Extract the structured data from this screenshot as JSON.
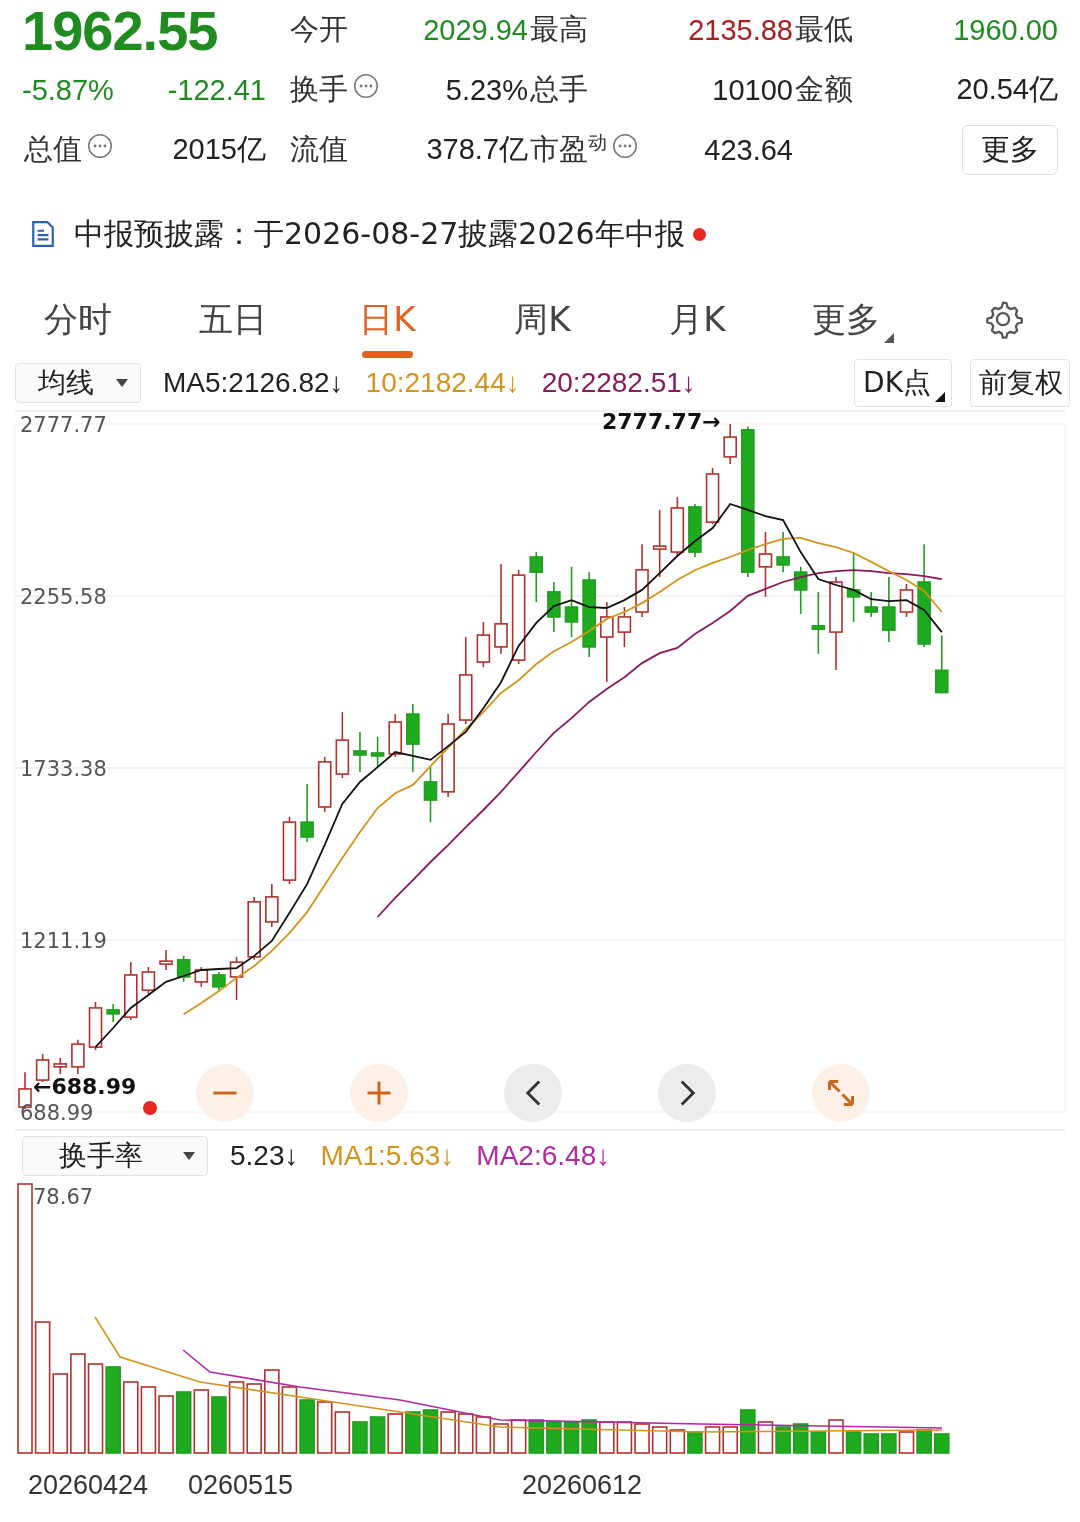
{
  "quote": {
    "price": "1962.55",
    "change_pct": "-5.87%",
    "change": "-122.41",
    "color": "#1f8c1f"
  },
  "stats": [
    {
      "label": "今开",
      "value": "2029.94",
      "color": "#1f8c1f",
      "info": false
    },
    {
      "label": "最高",
      "value": "2135.88",
      "color": "#a8211f",
      "info": false
    },
    {
      "label": "最低",
      "value": "1960.00",
      "color": "#1f8c1f",
      "info": false
    },
    {
      "label": "换手",
      "value": "5.23%",
      "color": "#222222",
      "info": true
    },
    {
      "label": "总手",
      "value": "10100",
      "color": "#222222",
      "info": false
    },
    {
      "label": "金额",
      "value": "20.54亿",
      "color": "#222222",
      "info": false
    },
    {
      "label": "总值",
      "value": "2015亿",
      "color": "#222222",
      "info": true
    },
    {
      "label": "流值",
      "value": "378.7亿",
      "color": "#222222",
      "info": false
    },
    {
      "label": "市盈",
      "sup": "动",
      "value": "423.64",
      "color": "#222222",
      "info": true
    }
  ],
  "more_button": "更多",
  "notice": {
    "text": "中报预披露：于2026-08-27披露2026年中报",
    "unread": true
  },
  "tabs": [
    {
      "label": "分时",
      "selected": false,
      "dropdown": false
    },
    {
      "label": "五日",
      "selected": false,
      "dropdown": false
    },
    {
      "label": "日K",
      "selected": true,
      "dropdown": false
    },
    {
      "label": "周K",
      "selected": false,
      "dropdown": false
    },
    {
      "label": "月K",
      "selected": false,
      "dropdown": false
    },
    {
      "label": "更多",
      "selected": false,
      "dropdown": true
    }
  ],
  "ma_bar": {
    "selector": "均线",
    "legend": [
      {
        "text": "MA5:2126.82↓",
        "color": "#222222"
      },
      {
        "text": "10:2182.44↓",
        "color": "#d4941c"
      },
      {
        "text": "20:2282.51↓",
        "color": "#8b1a5a"
      }
    ],
    "buttons": [
      {
        "label": "DK点",
        "dropdown": true
      },
      {
        "label": "前复权",
        "dropdown": false
      }
    ]
  },
  "price_chart": {
    "high_marker": "2777.77→",
    "low_marker": "←688.99",
    "chart_data": {
      "type": "candlestick",
      "grid": true,
      "ylim": [
        688.99,
        2777.77
      ],
      "yticks": [
        {
          "value": 2777.77,
          "label": "2777.77"
        },
        {
          "value": 2255.58,
          "label": "2255.58"
        },
        {
          "value": 1733.38,
          "label": "1733.38"
        },
        {
          "value": 1211.19,
          "label": "1211.19"
        },
        {
          "value": 688.99,
          "label": "688.99"
        }
      ],
      "ohlc": [
        [
          704,
          810,
          698,
          759
        ],
        [
          786,
          865,
          780,
          847
        ],
        [
          826,
          853,
          804,
          835
        ],
        [
          826,
          908,
          804,
          895
        ],
        [
          886,
          1023,
          877,
          1005
        ],
        [
          999,
          1017,
          962,
          987
        ],
        [
          977,
          1144,
          968,
          1105
        ],
        [
          1059,
          1129,
          1047,
          1114
        ],
        [
          1138,
          1181,
          1120,
          1147
        ],
        [
          1151,
          1163,
          1084,
          1099
        ],
        [
          1084,
          1129,
          1069,
          1120
        ],
        [
          1105,
          1114,
          1059,
          1069
        ],
        [
          1099,
          1160,
          1029,
          1144
        ],
        [
          1160,
          1342,
          1151,
          1327
        ],
        [
          1266,
          1381,
          1251,
          1342
        ],
        [
          1393,
          1585,
          1381,
          1569
        ],
        [
          1569,
          1685,
          1509,
          1524
        ],
        [
          1615,
          1767,
          1600,
          1752
        ],
        [
          1715,
          1903,
          1703,
          1818
        ],
        [
          1785,
          1843,
          1721,
          1773
        ],
        [
          1779,
          1828,
          1736,
          1770
        ],
        [
          1776,
          1897,
          1767,
          1873
        ],
        [
          1897,
          1928,
          1721,
          1806
        ],
        [
          1691,
          1736,
          1569,
          1636
        ],
        [
          1661,
          1897,
          1645,
          1867
        ],
        [
          1879,
          2131,
          1867,
          2016
        ],
        [
          2055,
          2177,
          2040,
          2137
        ],
        [
          2101,
          2353,
          2080,
          2171
        ],
        [
          2061,
          2335,
          2049,
          2319
        ],
        [
          2374,
          2389,
          2237,
          2328
        ],
        [
          2268,
          2298,
          2146,
          2192
        ],
        [
          2222,
          2344,
          2131,
          2177
        ],
        [
          2304,
          2328,
          2070,
          2101
        ],
        [
          2131,
          2237,
          1995,
          2192
        ],
        [
          2146,
          2222,
          2101,
          2192
        ],
        [
          2207,
          2413,
          2192,
          2335
        ],
        [
          2398,
          2517,
          2313,
          2407
        ],
        [
          2389,
          2556,
          2374,
          2523
        ],
        [
          2526,
          2535,
          2374,
          2389
        ],
        [
          2480,
          2644,
          2474,
          2626
        ],
        [
          2678,
          2777.77,
          2656,
          2738
        ],
        [
          2760,
          2770,
          2313,
          2328
        ],
        [
          2344,
          2450,
          2253,
          2383
        ],
        [
          2374,
          2450,
          2328,
          2350
        ],
        [
          2328,
          2344,
          2201,
          2274
        ],
        [
          2165,
          2268,
          2080,
          2155
        ],
        [
          2146,
          2313,
          2031,
          2298
        ],
        [
          2274,
          2389,
          2177,
          2253
        ],
        [
          2222,
          2268,
          2192,
          2207
        ],
        [
          2222,
          2313,
          2116,
          2152
        ],
        [
          2207,
          2292,
          2192,
          2274
        ],
        [
          2298,
          2413,
          2101,
          2110
        ],
        [
          2029.94,
          2135.88,
          1960.0,
          1962.55
        ]
      ],
      "series": [
        {
          "type": "line",
          "color": "#111111",
          "values": [
            null,
            null,
            null,
            null,
            886,
            944,
            1005,
            1044,
            1084,
            1102,
            1120,
            1123,
            1126,
            1163,
            1208,
            1293,
            1381,
            1500,
            1624,
            1691,
            1736,
            1782,
            1770,
            1758,
            1800,
            1843,
            1915,
            1994,
            2104,
            2174,
            2225,
            2243,
            2222,
            2219,
            2243,
            2274,
            2325,
            2377,
            2422,
            2462,
            2535,
            2517,
            2498,
            2486,
            2389,
            2307,
            2289,
            2274,
            2246,
            2240,
            2243,
            2213,
            2146
          ]
        },
        {
          "type": "line",
          "color": "#d4941c",
          "values": [
            null,
            null,
            null,
            null,
            null,
            null,
            null,
            null,
            null,
            986,
            1020,
            1056,
            1096,
            1132,
            1178,
            1232,
            1296,
            1378,
            1460,
            1539,
            1612,
            1657,
            1682,
            1739,
            1794,
            1852,
            1903,
            1961,
            2000,
            2049,
            2088,
            2116,
            2149,
            2186,
            2207,
            2234,
            2268,
            2304,
            2334,
            2356,
            2374,
            2395,
            2413,
            2429,
            2432,
            2416,
            2404,
            2386,
            2359,
            2331,
            2304,
            2271,
            2207
          ]
        },
        {
          "type": "line",
          "color": "#8b1a5a",
          "values": [
            null,
            null,
            null,
            null,
            null,
            null,
            null,
            null,
            null,
            null,
            null,
            null,
            null,
            null,
            null,
            null,
            null,
            null,
            null,
            null,
            1281,
            1339,
            1393,
            1448,
            1499,
            1554,
            1606,
            1661,
            1721,
            1782,
            1840,
            1885,
            1934,
            1973,
            2009,
            2052,
            2082,
            2098,
            2140,
            2174,
            2210,
            2256,
            2277,
            2298,
            2313,
            2325,
            2331,
            2334,
            2331,
            2325,
            2322,
            2316,
            2307
          ]
        }
      ]
    }
  },
  "turnover": {
    "selector": "换手率",
    "legend": [
      {
        "text": "5.23↓",
        "color": "#222222"
      },
      {
        "text": "MA1:5.63↓",
        "color": "#d4941c"
      },
      {
        "text": "MA2:6.48↓",
        "color": "#b02aa0"
      }
    ],
    "max_label": "78.67"
  },
  "dates": [
    "20260424",
    "0260515",
    "20260612"
  ]
}
